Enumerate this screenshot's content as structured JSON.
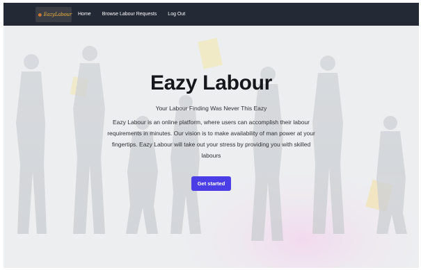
{
  "brand": {
    "logo_text": "EazyLabour"
  },
  "nav": {
    "items": [
      "Home",
      "Browse Labour Requests",
      "Log Out"
    ]
  },
  "hero": {
    "title": "Eazy Labour",
    "tagline": "Your Labour Finding Was Never This Eazy",
    "description": "Eazy Labour is an online platform, where users can accomplish their labour requirements in minutes. Our vision is to make availability of man power at your fingertips. Eazy Labour will take out your stress by providing you with skilled labours",
    "cta_label": "Get started"
  },
  "colors": {
    "navbar": "#232a36",
    "accent": "#4b3ee6",
    "logo_text": "#f1b23c"
  }
}
